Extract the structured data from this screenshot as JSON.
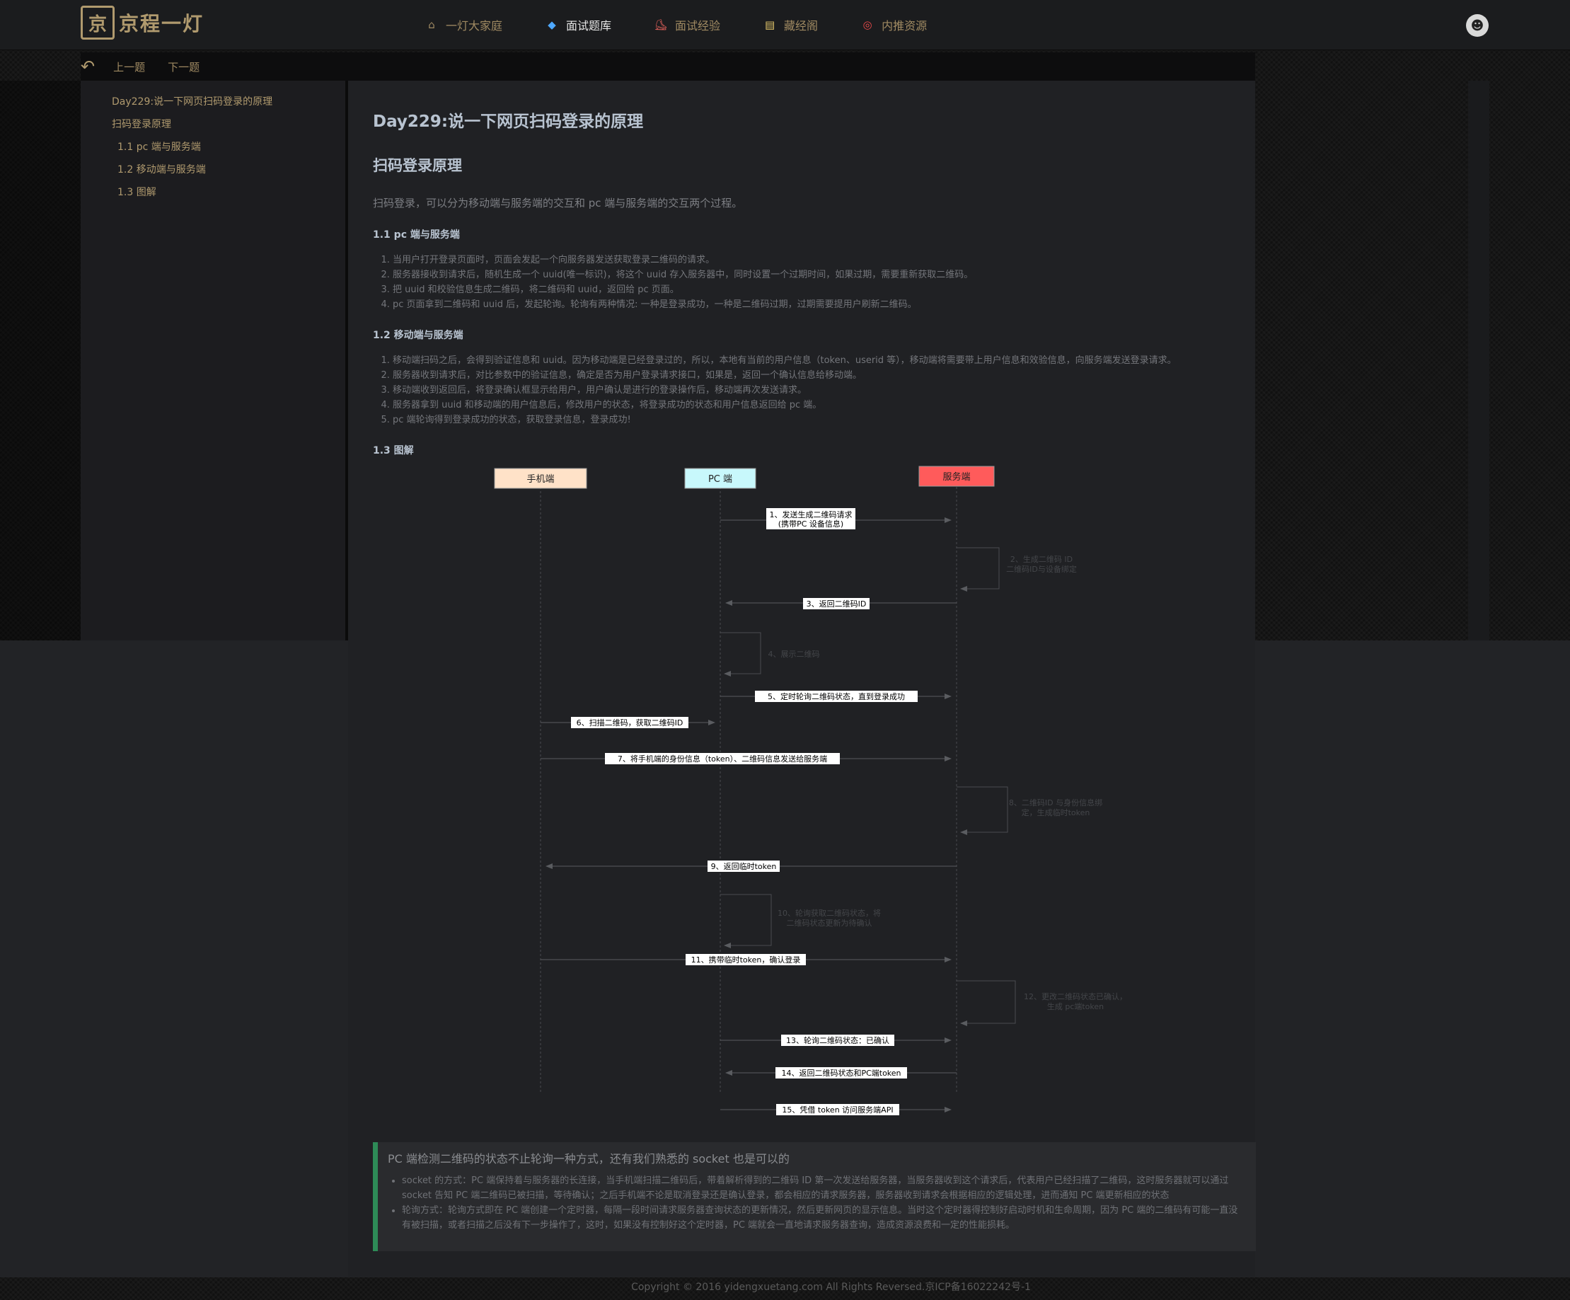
{
  "brand": {
    "logo_mark": "京",
    "name": "京程一灯"
  },
  "nav": [
    {
      "label": "一灯大家庭",
      "icon": "home-icon",
      "glyph": "⌂"
    },
    {
      "label": "面试题库",
      "icon": "diamond-icon",
      "glyph": "◆"
    },
    {
      "label": "面试经验",
      "icon": "shoe-icon",
      "glyph": "⛸"
    },
    {
      "label": "藏经阁",
      "icon": "book-icon",
      "glyph": "▤"
    },
    {
      "label": "内推资源",
      "icon": "target-icon",
      "glyph": "◎"
    }
  ],
  "subnav": {
    "back_glyph": "↶",
    "prev": "上一题",
    "next": "下一题"
  },
  "toc": [
    {
      "label": "Day229:说一下网页扫码登录的原理",
      "level": 1
    },
    {
      "label": "扫码登录原理",
      "level": 1
    },
    {
      "label": "1.1 pc 端与服务端",
      "level": 2
    },
    {
      "label": "1.2 移动端与服务端",
      "level": 2
    },
    {
      "label": "1.3 图解",
      "level": 2
    }
  ],
  "article": {
    "title": "Day229:说一下网页扫码登录的原理",
    "h2": "扫码登录原理",
    "intro": "扫码登录，可以分为移动端与服务端的交互和 pc 端与服务端的交互两个过程。",
    "s1_title": "1.1 pc 端与服务端",
    "s1_items": [
      "当用户打开登录页面时，页面会发起一个向服务器发送获取登录二维码的请求。",
      "服务器接收到请求后，随机生成一个 uuid(唯一标识)，将这个 uuid 存入服务器中，同时设置一个过期时间，如果过期，需要重新获取二维码。",
      "把 uuid 和校验信息生成二维码，将二维码和 uuid，返回给 pc 页面。",
      "pc 页面拿到二维码和 uuid 后，发起轮询。轮询有两种情况: 一种是登录成功，一种是二维码过期，过期需要提用户刷新二维码。"
    ],
    "s2_title": "1.2 移动端与服务端",
    "s2_items": [
      "移动端扫码之后，会得到验证信息和 uuid。因为移动端是已经登录过的，所以，本地有当前的用户信息（token、userid 等），移动端将需要带上用户信息和效验信息，向服务端发送登录请求。",
      "服务器收到请求后，对比参数中的验证信息，确定是否为用户登录请求接口，如果是，返回一个确认信息给移动端。",
      "移动端收到返回后，将登录确认框显示给用户，用户确认是进行的登录操作后，移动端再次发送请求。",
      "服务器拿到 uuid 和移动端的用户信息后，修改用户的状态，将登录成功的状态和用户信息返回给 pc 端。",
      "pc 端轮询得到登录成功的状态，获取登录信息，登录成功!"
    ],
    "s3_title": "1.3 图解"
  },
  "diagram": {
    "actors": [
      {
        "label": "手机端",
        "fill": "#ffe2c8"
      },
      {
        "label": "PC 端",
        "fill": "#c8f8fc"
      },
      {
        "label": "服务端",
        "fill": "#ff5b5b"
      }
    ],
    "messages": [
      {
        "label": "1、发送生成二维码请求",
        "label2": "(携带PC 设备信息)"
      },
      {
        "label": "3、返回二维码ID"
      },
      {
        "label": "5、定时轮询二维码状态，直到登录成功"
      },
      {
        "label": "6、扫描二维码，获取二维码ID"
      },
      {
        "label": "7、将手机端的身份信息（token）、二维码信息发送给服务端"
      },
      {
        "label": "9、返回临时token"
      },
      {
        "label": "11、携带临时token，确认登录"
      },
      {
        "label": "13、轮询二维码状态：已确认"
      },
      {
        "label": "14、返回二维码状态和PC端token"
      },
      {
        "label": "15、凭借 token 访问服务端API"
      }
    ],
    "self_notes": [
      {
        "line1": "2、生成二维码 ID",
        "line2": "二维码ID与设备绑定"
      },
      {
        "line1": "4、展示二维码",
        "line2": ""
      },
      {
        "line1": "8、二维码ID 与身份信息绑",
        "line2": "定，生成临时token"
      },
      {
        "line1": "10、轮询获取二维码状态，将",
        "line2": "二维码状态更新为待确认"
      },
      {
        "line1": "12、更改二维码状态已确认，",
        "line2": "生成 pc端token"
      }
    ]
  },
  "callout": {
    "title": "PC 端检测二维码的状态不止轮询一种方式，还有我们熟悉的 socket 也是可以的",
    "items": [
      "socket 的方式：PC 端保持着与服务器的长连接，当手机端扫描二维码后，带着解析得到的二维码 ID 第一次发送给服务器，当服务器收到这个请求后，代表用户已经扫描了二维码，这时服务器就可以通过 socket 告知 PC 端二维码已被扫描，等待确认；之后手机端不论是取消登录还是确认登录，都会相应的请求服务器，服务器收到请求会根据相应的逻辑处理，进而通知 PC 端更新相应的状态",
      "轮询方式：轮询方式即在 PC 端创建一个定时器，每隔一段时间请求服务器查询状态的更新情况，然后更新网页的显示信息。当时这个定时器得控制好启动时机和生命周期，因为 PC 端的二维码有可能一直没有被扫描，或者扫描之后没有下一步操作了，这时，如果没有控制好这个定时器，PC 端就会一直地请求服务器查询，造成资源浪费和一定的性能损耗。"
    ]
  },
  "footer": "Copyright © 2016 yidengxuetang.com All Rights Reversed.京ICP备16022242号-1"
}
